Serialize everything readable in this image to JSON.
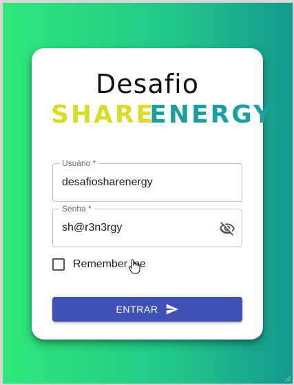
{
  "logo": {
    "title": "Desafio",
    "brand_part1": "SHARE",
    "brand_part2": "ENERGY"
  },
  "form": {
    "username": {
      "label": "Usuário *",
      "value": "desafiosharenergy"
    },
    "password": {
      "label": "Senha *",
      "value": "sh@r3n3rgy",
      "visibility_icon": "eye-off-icon"
    },
    "remember": {
      "label": "Remember me",
      "checked": false
    },
    "submit": {
      "label": "ENTRAR",
      "icon": "send-icon"
    }
  },
  "colors": {
    "gradient_start": "#2ee87a",
    "gradient_end": "#13998e",
    "button": "#3f51b5",
    "brand_share": "#d9dd2a",
    "brand_energy": "#1aa0a0"
  }
}
